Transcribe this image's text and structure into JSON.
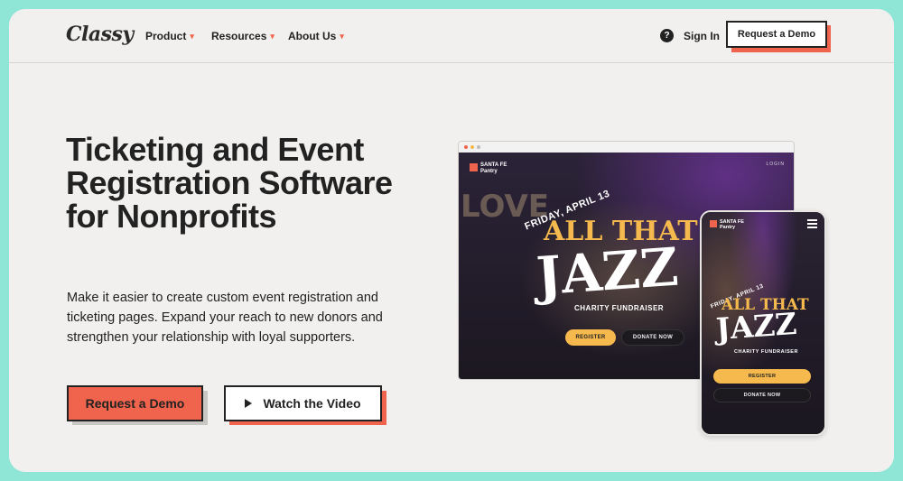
{
  "header": {
    "logo": "Classy",
    "nav": [
      {
        "label": "Product"
      },
      {
        "label": "Resources"
      },
      {
        "label": "About Us"
      }
    ],
    "help_icon": "?",
    "sign_in": "Sign In",
    "request_demo": "Request a Demo"
  },
  "hero": {
    "title": "Ticketing and Event Registration Software for Nonprofits",
    "subtitle": "Make it easier to create custom event registration and ticketing pages. Expand your reach to new donors and strengthen your relationship with loyal supporters.",
    "cta_primary": "Request a Demo",
    "cta_secondary": "Watch the Video"
  },
  "mockups": {
    "brand_line1": "SANTA FE",
    "brand_line2": "Pantry",
    "nav_links": "LOGIN",
    "date": "FRIDAY, APRIL 13",
    "title_line1": "ALL THAT",
    "title_line2": "JAZZ",
    "subtitle": "CHARITY FUNDRAISER",
    "register": "REGISTER",
    "donate": "DONATE NOW",
    "background_text": "LOVE"
  },
  "colors": {
    "accent": "#f0634c",
    "mint": "#8fe6d6",
    "gold": "#f5b94d"
  }
}
